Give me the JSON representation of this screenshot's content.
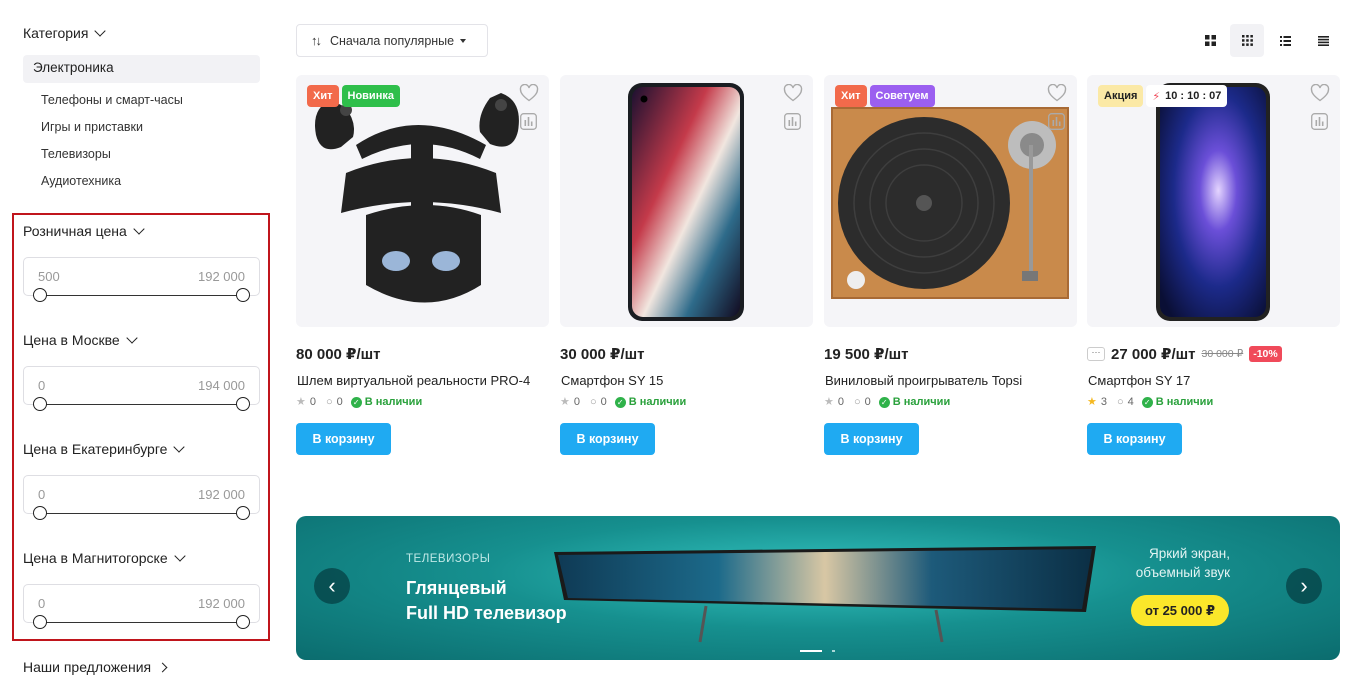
{
  "sidebar": {
    "category_title": "Категория",
    "active_category": "Электроника",
    "subcategories": [
      "Телефоны и смарт-часы",
      "Игры и приставки",
      "Телевизоры",
      "Аудиотехника"
    ],
    "filters": [
      {
        "label": "Розничная цена",
        "min": "500",
        "max": "192 000"
      },
      {
        "label": "Цена в Москве",
        "min": "0",
        "max": "194 000"
      },
      {
        "label": "Цена в Екатеринбурге",
        "min": "0",
        "max": "192 000"
      },
      {
        "label": "Цена в Магнитогорске",
        "min": "0",
        "max": "192 000"
      }
    ],
    "offers_title": "Наши предложения"
  },
  "toolbar": {
    "sort_label": "Сначала популярные",
    "views": [
      "grid-large-icon",
      "grid-small-icon",
      "list-icon",
      "table-icon"
    ],
    "active_view": 1
  },
  "products": [
    {
      "badges": [
        {
          "text": "Хит",
          "color": "#f26a4b"
        },
        {
          "text": "Новинка",
          "color": "#2fbf4b"
        }
      ],
      "price": "80 000 ₽/шт",
      "title": "Шлем виртуальной реальности PRO-4",
      "rating": "0",
      "reviews": "0",
      "stock": "В наличии",
      "button": "В корзину"
    },
    {
      "badges": [],
      "price": "30 000 ₽/шт",
      "title": "Смартфон SY 15",
      "rating": "0",
      "reviews": "0",
      "stock": "В наличии",
      "button": "В корзину"
    },
    {
      "badges": [
        {
          "text": "Хит",
          "color": "#f26a4b"
        },
        {
          "text": "Советуем",
          "color": "#9b5ff0"
        }
      ],
      "price": "19 500 ₽/шт",
      "title": "Виниловый проигрыватель Topsi",
      "rating": "0",
      "reviews": "0",
      "stock": "В наличии",
      "button": "В корзину"
    },
    {
      "badges": [
        {
          "text": "Акция",
          "color": "#fbe9a6"
        }
      ],
      "timer": "10 : 10 : 07",
      "more": "···",
      "price": "27 000 ₽/шт",
      "old_price": "30 000 ₽",
      "discount": "-10%",
      "title": "Смартфон SY 17",
      "rating": "3",
      "reviews": "4",
      "stock": "В наличии",
      "button": "В корзину"
    }
  ],
  "banner": {
    "kicker": "ТЕЛЕВИЗОРЫ",
    "title_line1": "Глянцевый",
    "title_line2": "Full HD телевизор",
    "side_line1": "Яркий экран,",
    "side_line2": "объемный звук",
    "price": "от 25 000 ₽",
    "prev": "‹",
    "next": "›"
  }
}
